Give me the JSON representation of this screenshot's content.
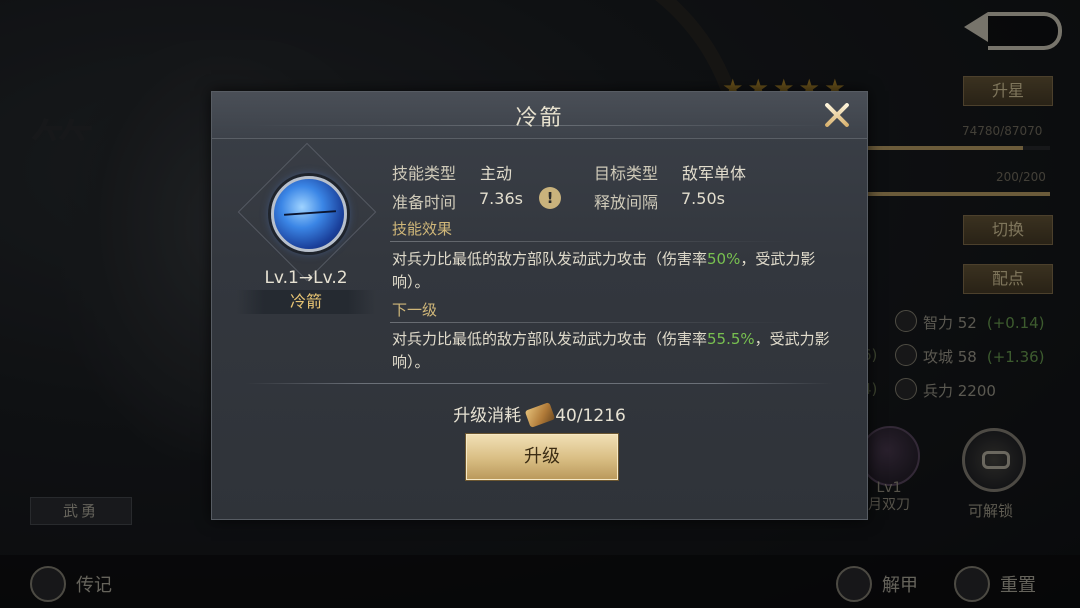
{
  "background": {
    "back_icon": "back-arrow-icon",
    "stars": "★★★★★",
    "upgrade_star_button": "升星",
    "exp_text": "74780/87070",
    "exp_progress": 0.859,
    "troop_text": "200/200",
    "troop_progress": 1.0,
    "switch_button": "切换",
    "assign_points_button": "配点",
    "stats": [
      {
        "icon": "intelligence-icon",
        "label": "智力 52",
        "bonus": "(+0.14)"
      },
      {
        "icon": "siege-icon",
        "label": "攻城 58",
        "bonus": "(+1.36)"
      },
      {
        "icon": "troops-icon",
        "label": "兵力 2200",
        "bonus": ""
      }
    ],
    "ghost_numbers": [
      ")",
      "6)",
      "4)"
    ],
    "equip_label_line1": "Lv1",
    "equip_label_line2": "月双刀",
    "unlock_label": "可解锁",
    "trait_tag": "武勇",
    "bottom": {
      "biography": "传记",
      "unequip": "解甲",
      "reset": "重置"
    }
  },
  "dialog": {
    "title": "冷箭",
    "close_icon": "close-x-icon",
    "skill_icon": "arrow-skill-icon",
    "level": "Lv.1→Lv.2",
    "skill_name": "冷箭",
    "skill_type_label": "技能类型",
    "skill_type_value": "主动",
    "target_type_label": "目标类型",
    "target_type_value": "敌军单体",
    "prep_time_label": "准备时间",
    "prep_time_value": "7.36s",
    "info_icon": "!",
    "cast_interval_label": "释放间隔",
    "cast_interval_value": "7.50s",
    "effect_label": "技能效果",
    "effect_prefix": "对兵力比最低的敌方部队发动武力攻击（伤害率",
    "effect_value": "50%",
    "effect_suffix": "，受武力影响）。",
    "next_level_label": "下一级",
    "next_prefix": "对兵力比最低的敌方部队发动武力攻击（伤害率",
    "next_value": "55.5%",
    "next_suffix": "，受武力影响）。",
    "cost_label": "升级消耗",
    "cost_icon": "skill-scroll-icon",
    "cost_value": "40/1216",
    "upgrade_button": "升级"
  }
}
